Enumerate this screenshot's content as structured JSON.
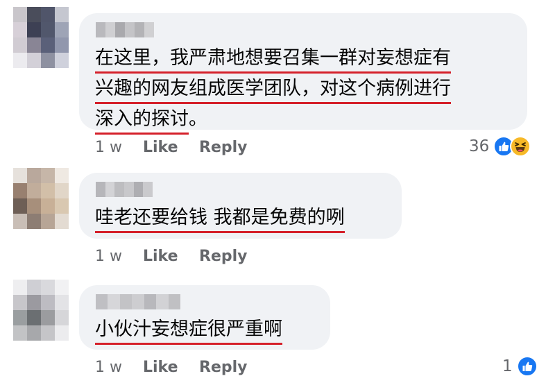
{
  "comments": [
    {
      "lines": [
        "在这里，我严肃地想要召集一群对妄想症有",
        "兴趣的网友组成医学团队，对这个病例进行",
        "深入的探讨"
      ],
      "trailing": "。",
      "time": "1 w",
      "like_label": "Like",
      "reply_label": "Reply",
      "reaction_count": "36",
      "reactions": [
        "like-icon",
        "haha-icon"
      ],
      "avatar_pixels": [
        "#c9c6cb",
        "#4a4d5b",
        "#50556a",
        "#c5c7d0",
        "#d7d0d8",
        "#3d4054",
        "#51576c",
        "#9ea4b6",
        "#d1ccd3",
        "#898595",
        "#5a6079",
        "#9197ad",
        "#ecebef",
        "#d3d0d8",
        "#8e91a1",
        "#cfd1dc"
      ],
      "name_pixels": [
        "#b9b9bd",
        "#cfcfd2",
        "#a9a9ad",
        "#c4c4c7",
        "#b3b3b6",
        "#d0d0d2"
      ]
    },
    {
      "lines": [
        "哇老还要给钱 我都是免费的咧"
      ],
      "trailing": "",
      "time": "1 w",
      "like_label": "Like",
      "reply_label": "Reply",
      "reaction_count": "",
      "reactions": [],
      "avatar_pixels": [
        "#e6e1dc",
        "#b9a89c",
        "#c6b6a8",
        "#efe9e2",
        "#988070",
        "#c1ad9b",
        "#d2bfa8",
        "#e1d6c8",
        "#6e5f56",
        "#a78f7b",
        "#c8b097",
        "#d9c8b1",
        "#c9beb6",
        "#8d7d73",
        "#b7a596",
        "#e3dbd2"
      ],
      "name_pixels": [
        "#b6b6ba",
        "#d3d3d6",
        "#bdbdc0",
        "#c8c8cb",
        "#aeaeb2",
        "#cacacd"
      ]
    },
    {
      "lines": [
        "小伙汁妄想症很严重啊"
      ],
      "trailing": "",
      "time": "1 w",
      "like_label": "Like",
      "reply_label": "Reply",
      "reaction_count": "1",
      "reactions": [
        "like-icon"
      ],
      "avatar_pixels": [
        "#eeeef0",
        "#cfcfd4",
        "#d9d9dd",
        "#f1f1f3",
        "#c7c6ca",
        "#9b9aa0",
        "#bdbcc2",
        "#e3e3e6",
        "#9a9ea0",
        "#6b6f72",
        "#9b9c9f",
        "#d6d6d9",
        "#c2c3c5",
        "#a7a8ab",
        "#c5c5c8",
        "#ececee"
      ],
      "name_pixels": [
        "#bfbfc3",
        "#d6d6d9",
        "#c3c3c6",
        "#cdcdd0",
        "#b8b8bc",
        "#d2d2d5",
        "#c0c0c3"
      ]
    }
  ],
  "colors": {
    "bubble": "#f0f2f5",
    "text": "#050505",
    "meta": "#65676b",
    "underline": "#d5202a",
    "like_blue": "#1877f2",
    "haha_yellow": "#f7b928"
  }
}
